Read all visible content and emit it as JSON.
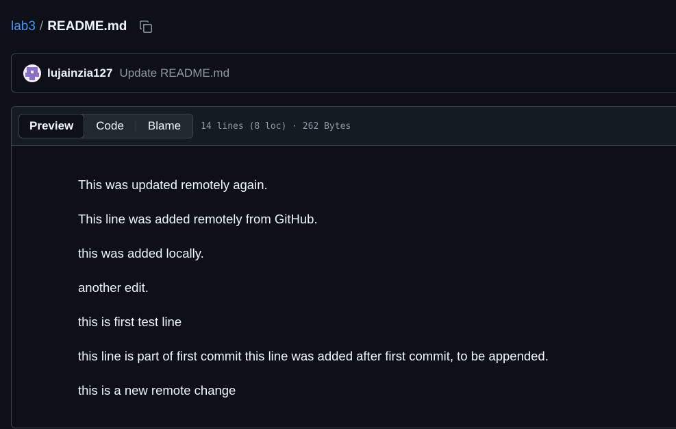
{
  "breadcrumb": {
    "repo": "lab3",
    "separator": "/",
    "file": "README.md"
  },
  "commit": {
    "author": "lujainzia127",
    "message": "Update README.md"
  },
  "file_header": {
    "tabs": [
      {
        "label": "Preview",
        "active": true
      },
      {
        "label": "Code",
        "active": false
      },
      {
        "label": "Blame",
        "active": false
      }
    ],
    "meta": "14 lines (8 loc) · 262 Bytes"
  },
  "content": {
    "paragraphs": [
      "This was updated remotely again.",
      "This line was added remotely from GitHub.",
      "this was added locally.",
      "another edit.",
      "this is first test line",
      "this line is part of first commit this line was added after first commit, to be appended.",
      "this is a new remote change"
    ]
  },
  "colors": {
    "background": "#0d1117",
    "link": "#4493f8",
    "border": "#3d444d",
    "muted": "#9198a1"
  }
}
